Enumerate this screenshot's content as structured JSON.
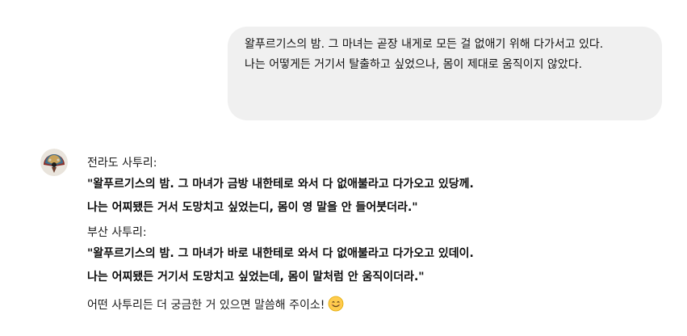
{
  "user_message": {
    "line1": "왈푸르기스의 밤. 그 마녀는 곧장 내게로 모든 걸 없애기 위해 다가서고 있다.",
    "line2": "나는 어떻게든 거기서 탈출하고 싶었으나, 몸이 제대로 움직이지 않았다."
  },
  "assistant": {
    "avatar_icon": "fan-avatar-icon",
    "jeolla_label": "전라도 사투리:",
    "jeolla_line1": "\"왈푸르기스의 밤. 그 마녀가 금방 내한테로 와서 다 없애불라고 다가오고 있당께.",
    "jeolla_line2": "나는 어찌됐든 거서 도망치고 싶었는디, 몸이 영 말을 안 들어붓더라.\"",
    "busan_label": "부산 사투리:",
    "busan_line1": "\"왈푸르기스의 밤. 그 마녀가 바로 내한테로 와서 다 없애불라고 다가오고 있데이.",
    "busan_line2": "나는 어찌됐든 거기서 도망치고 싶었는데, 몸이 말처럼 안 움직이더라.\"",
    "outro": "어떤 사투리든 더 궁금한 거 있으면 말씀해 주이소!",
    "emoji_icon": "smiling-face-emoji-icon"
  }
}
